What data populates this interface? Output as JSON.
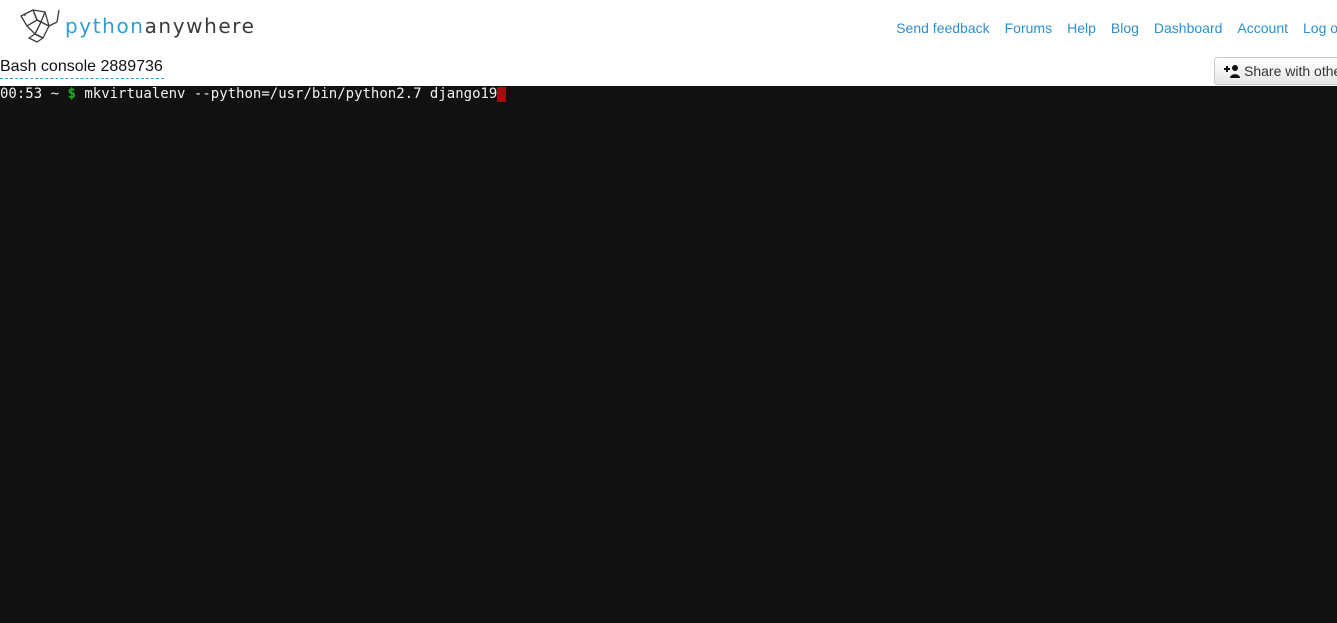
{
  "header": {
    "logo": {
      "part_python": "python",
      "part_anywhere": "anywhere",
      "icon": "pythonanywhere-logo-icon"
    },
    "nav": [
      {
        "label": "Send feedback"
      },
      {
        "label": "Forums"
      },
      {
        "label": "Help"
      },
      {
        "label": "Blog"
      },
      {
        "label": "Dashboard"
      },
      {
        "label": "Account"
      },
      {
        "label": "Log out"
      }
    ]
  },
  "console": {
    "title": "Bash console 2889736",
    "share_button_label": "Share with others",
    "share_icon": "add-user-icon"
  },
  "terminal": {
    "prompt_time": "00:53",
    "prompt_dir": "~",
    "prompt_symbol": "$",
    "command": "mkvirtualenv --python=/usr/bin/python2.7 django19"
  },
  "colors": {
    "brand_blue": "#2f9fd3",
    "link_blue": "#2e8fca",
    "terminal_bg": "#111111",
    "prompt_green": "#19b31e",
    "cursor_red": "#a30d0d"
  }
}
